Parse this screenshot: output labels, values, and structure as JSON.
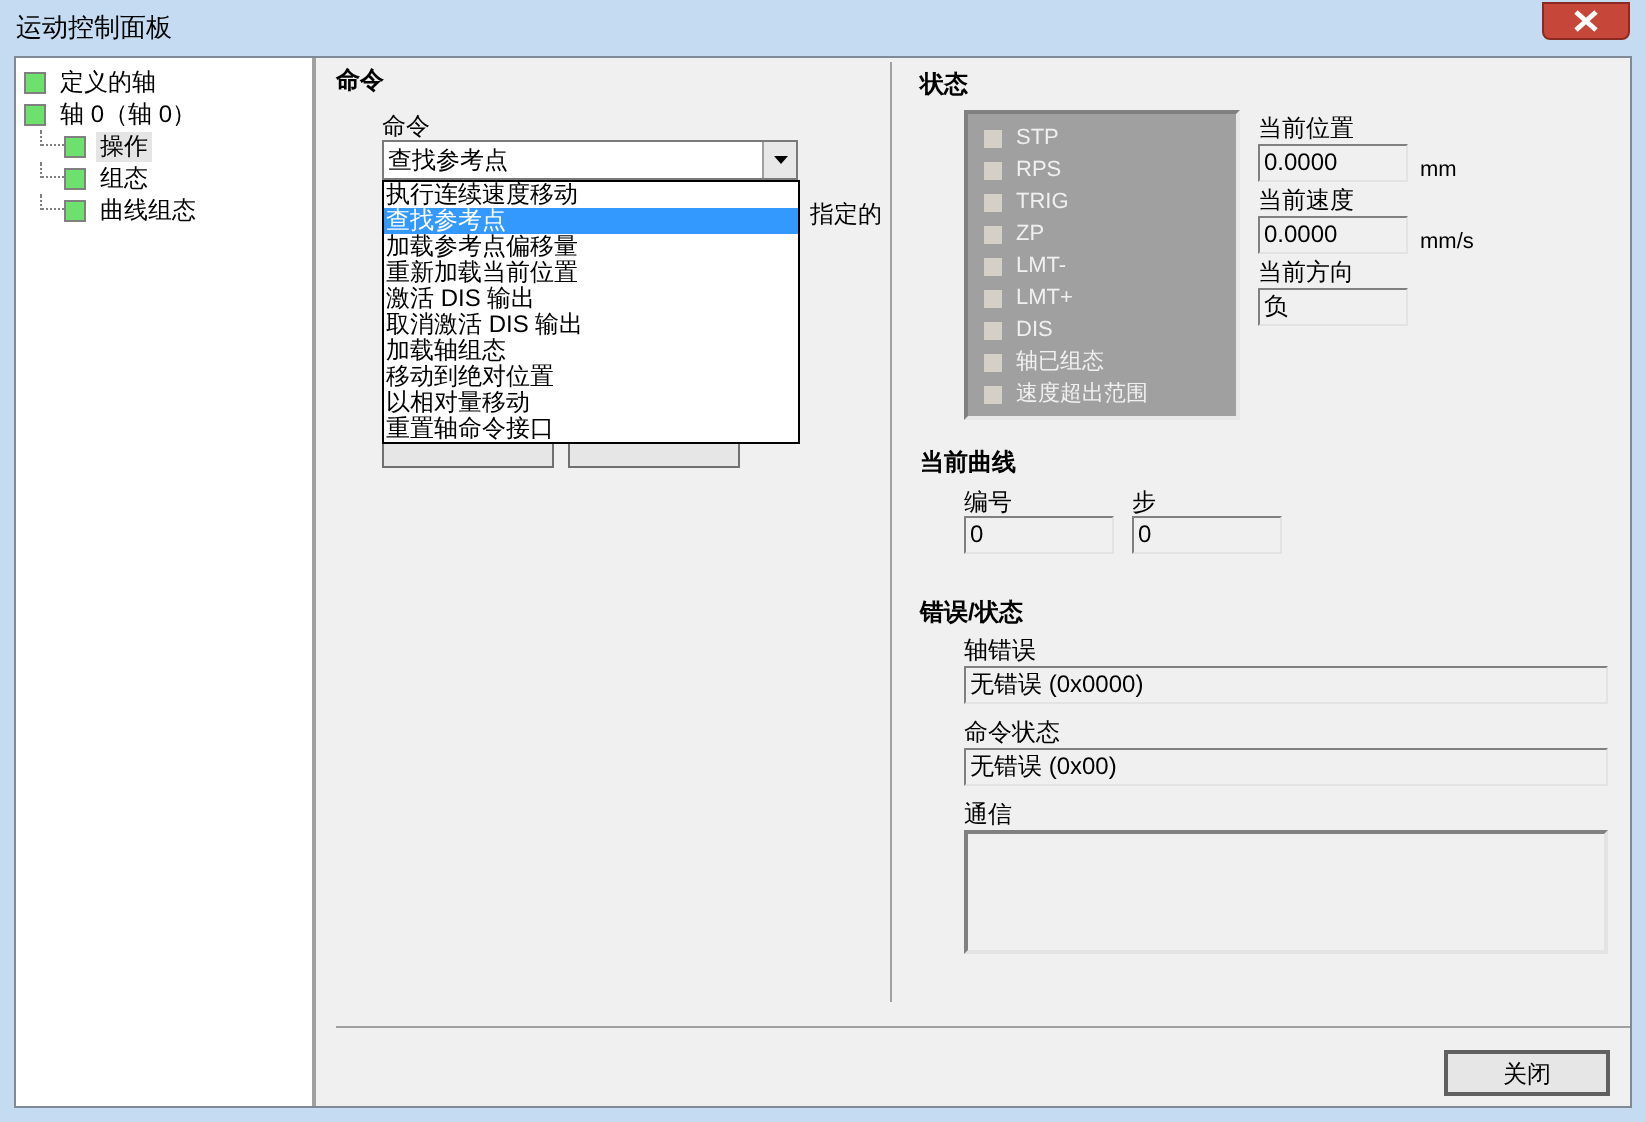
{
  "window": {
    "title": "运动控制面板"
  },
  "tree": [
    {
      "label": "定义的轴",
      "selected": false
    },
    {
      "label": "轴 0（轴 0）",
      "selected": false,
      "children": [
        {
          "label": "操作",
          "selected": true
        },
        {
          "label": "组态",
          "selected": false
        },
        {
          "label": "曲线组态",
          "selected": false
        }
      ]
    }
  ],
  "command": {
    "heading": "命令",
    "label": "命令",
    "value": "查找参考点",
    "expanded": true,
    "options": [
      {
        "label": "执行连续速度移动",
        "selected": false
      },
      {
        "label": "查找参考点",
        "selected": true
      },
      {
        "label": "加载参考点偏移量",
        "selected": false
      },
      {
        "label": "重新加载当前位置",
        "selected": false
      },
      {
        "label": "激活 DIS 输出",
        "selected": false
      },
      {
        "label": "取消激活 DIS 输出",
        "selected": false
      },
      {
        "label": "加载轴组态",
        "selected": false
      },
      {
        "label": "移动到绝对位置",
        "selected": false
      },
      {
        "label": "以相对量移动",
        "selected": false
      },
      {
        "label": "重置轴命令接口",
        "selected": false
      }
    ],
    "description": "指定的"
  },
  "status": {
    "heading": "状态",
    "flags": [
      {
        "label": "STP",
        "on": false
      },
      {
        "label": "RPS",
        "on": false
      },
      {
        "label": "TRIG",
        "on": false
      },
      {
        "label": "ZP",
        "on": false
      },
      {
        "label": "LMT-",
        "on": false
      },
      {
        "label": "LMT+",
        "on": false
      },
      {
        "label": "DIS",
        "on": false
      },
      {
        "label": "轴已组态",
        "on": false
      },
      {
        "label": "速度超出范围",
        "on": false
      }
    ],
    "fields": [
      {
        "label": "当前位置",
        "value": "0.0000",
        "unit": "mm"
      },
      {
        "label": "当前速度",
        "value": "0.0000",
        "unit": "mm/s"
      },
      {
        "label": "当前方向",
        "value": "负"
      }
    ]
  },
  "curve": {
    "heading": "当前曲线",
    "fields": [
      {
        "label": "编号",
        "value": "0"
      },
      {
        "label": "步",
        "value": "0"
      }
    ]
  },
  "errors": {
    "heading": "错误/状态",
    "fields": [
      {
        "label": "轴错误",
        "value": "无错误 (0x0000)",
        "kind": "line"
      },
      {
        "label": "命令状态",
        "value": "无错误 (0x00)",
        "kind": "line"
      },
      {
        "label": "通信",
        "kind": "box"
      }
    ]
  },
  "close_button": "关闭"
}
